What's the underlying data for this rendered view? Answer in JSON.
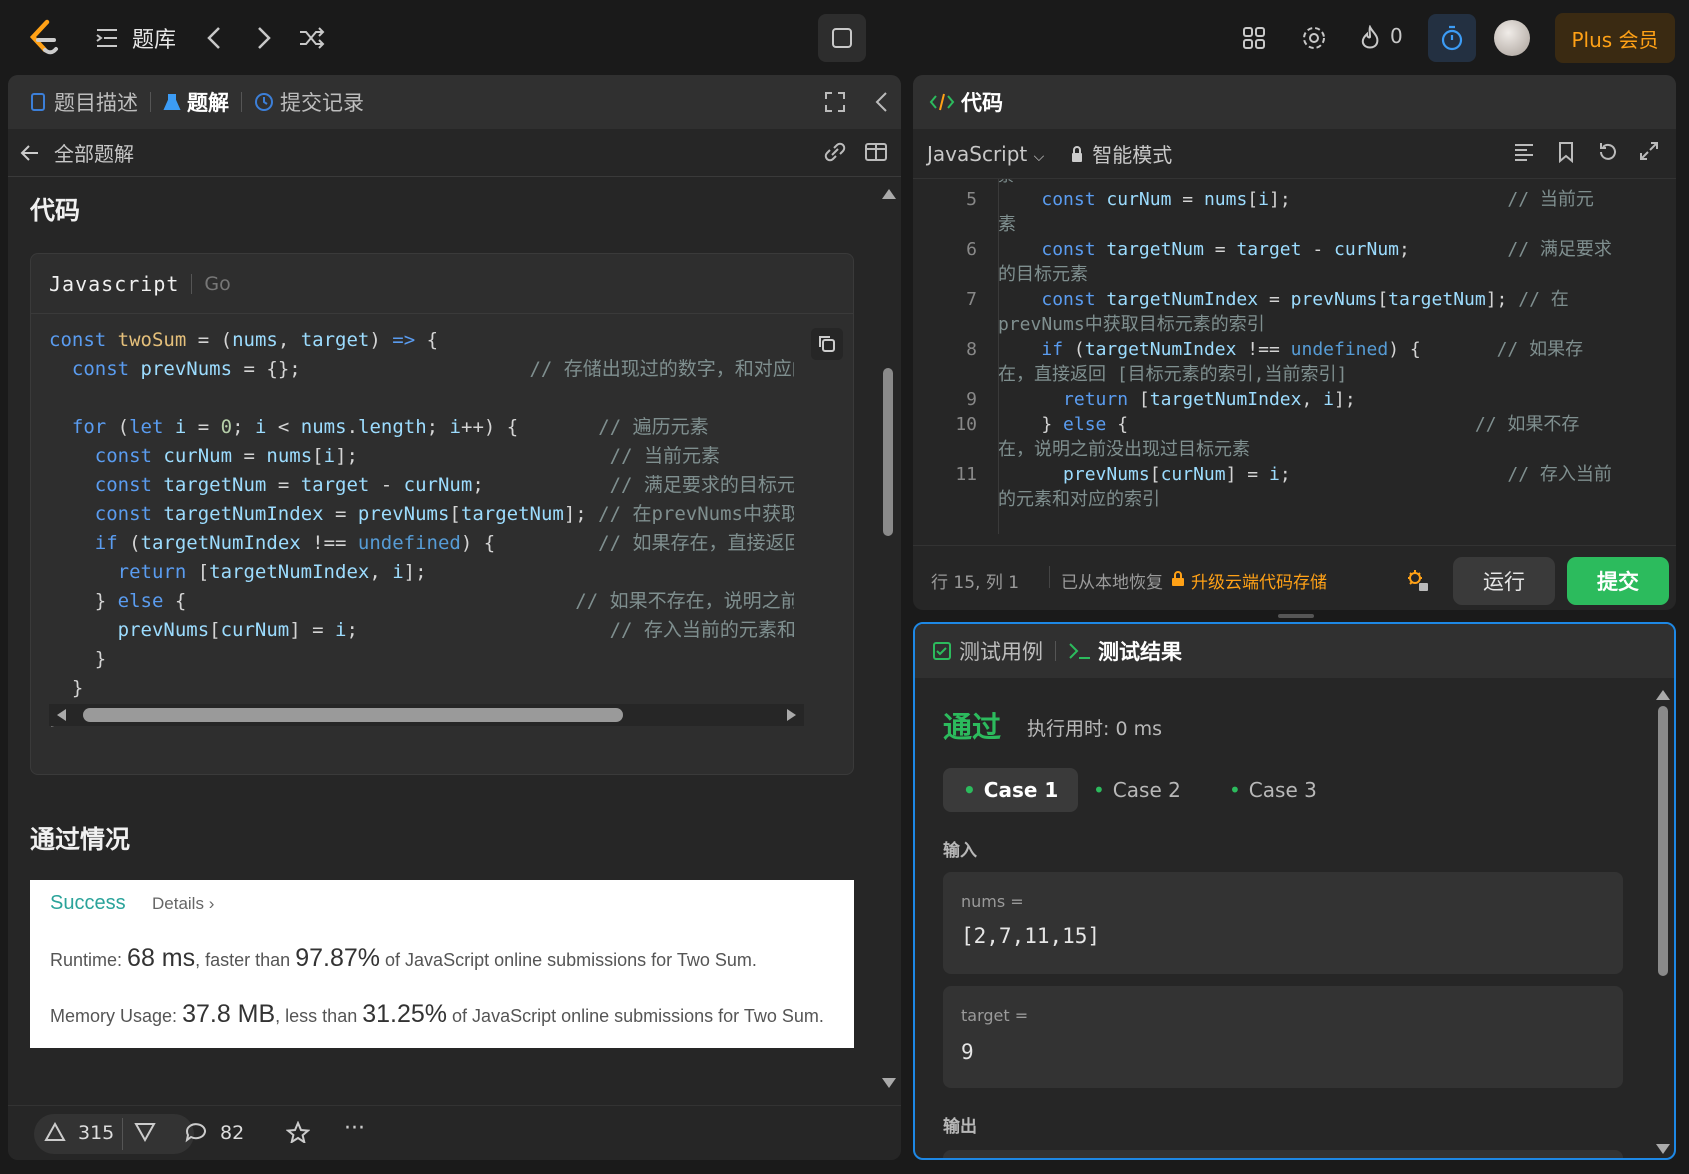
{
  "topbar": {
    "library": "题库",
    "streak": "0",
    "plus": "Plus 会员"
  },
  "left_panel": {
    "tabs": [
      "题目描述",
      "题解",
      "提交记录"
    ],
    "back_label": "全部题解",
    "code_heading": "代码",
    "lang_tabs": [
      "Javascript",
      "Go"
    ],
    "pass_heading": "通过情况",
    "result": {
      "status": "Success",
      "details": "Details",
      "runtime_label": "Runtime:",
      "runtime_value": "68 ms",
      "runtime_mid": ", faster than",
      "runtime_pct": "97.87%",
      "runtime_tail": "of JavaScript online submissions for Two Sum.",
      "memory_label": "Memory Usage:",
      "memory_value": "37.8 MB",
      "memory_mid": ", less than",
      "memory_pct": "31.25%",
      "memory_tail": "of JavaScript online submissions for Two Sum."
    },
    "footer": {
      "likes": "315",
      "comments": "82"
    }
  },
  "code_panel": {
    "title": "代码",
    "language": "JavaScript",
    "mode": "智能模式",
    "status": "行 15, 列 1",
    "restored": "已从本地恢复",
    "upgrade": "升级云端代码存储",
    "run": "运行",
    "submit": "提交"
  },
  "test_panel": {
    "tab_cases": "测试用例",
    "tab_result": "测试结果",
    "verdict": "通过",
    "exec_time": "执行用时: 0 ms",
    "cases": [
      "Case 1",
      "Case 2",
      "Case 3"
    ],
    "input_label": "输入",
    "output_label": "输出",
    "nums_label": "nums =",
    "nums_value": "[2,7,11,15]",
    "target_label": "target =",
    "target_value": "9"
  },
  "colors": {
    "accent_green": "#2cbb5d",
    "accent_orange": "#ffa116",
    "focus_blue": "#1e88e5"
  }
}
